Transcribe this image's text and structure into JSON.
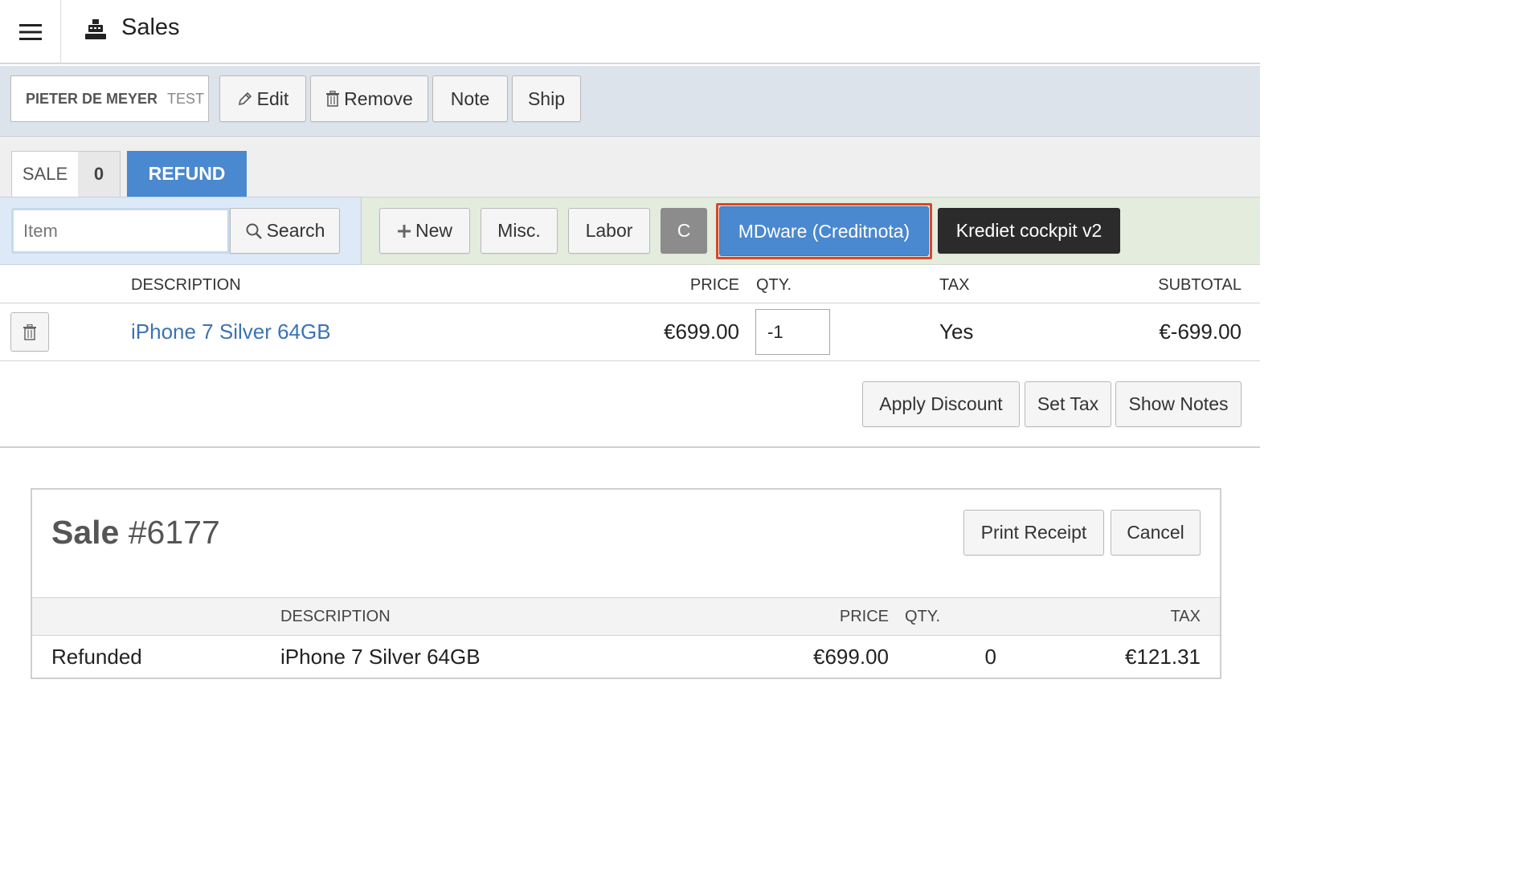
{
  "header": {
    "title": "Sales",
    "menu_icon": "hamburger-icon",
    "app_icon": "cash-register-icon"
  },
  "customer": {
    "name": "PIETER DE MEYER",
    "tag": "TEST"
  },
  "customer_actions": {
    "edit": "Edit",
    "remove": "Remove",
    "note": "Note",
    "ship": "Ship"
  },
  "tabs": {
    "sale_label": "SALE",
    "sale_count": "0",
    "refund_label": "REFUND"
  },
  "item_search": {
    "placeholder": "Item",
    "search_label": "Search"
  },
  "item_actions": {
    "new": "New",
    "misc": "Misc.",
    "labor": "Labor",
    "c": "C",
    "mdware": "MDware (Creditnota)",
    "krediet": "Krediet cockpit v2"
  },
  "line_items": {
    "headers": {
      "description": "DESCRIPTION",
      "price": "PRICE",
      "qty": "QTY.",
      "tax": "TAX",
      "subtotal": "SUBTOTAL"
    },
    "rows": [
      {
        "description": "iPhone 7 Silver 64GB",
        "price": "€699.00",
        "qty": "-1",
        "tax": "Yes",
        "subtotal": "€-699.00"
      }
    ]
  },
  "line_actions": {
    "apply_discount": "Apply Discount",
    "set_tax": "Set Tax",
    "show_notes": "Show Notes"
  },
  "sale_card": {
    "title_prefix": "Sale",
    "title_number": "#6177",
    "print_receipt": "Print Receipt",
    "cancel": "Cancel",
    "headers": {
      "description": "DESCRIPTION",
      "price": "PRICE",
      "qty": "QTY.",
      "tax": "TAX"
    },
    "rows": [
      {
        "status": "Refunded",
        "description": "iPhone 7 Silver 64GB",
        "price": "€699.00",
        "qty": "0",
        "tax": "€121.31"
      }
    ]
  },
  "colors": {
    "accent_blue": "#4a88cf",
    "highlight_red": "#d9472b",
    "dark_button": "#2b2b2b",
    "link_blue": "#3b73b5"
  }
}
